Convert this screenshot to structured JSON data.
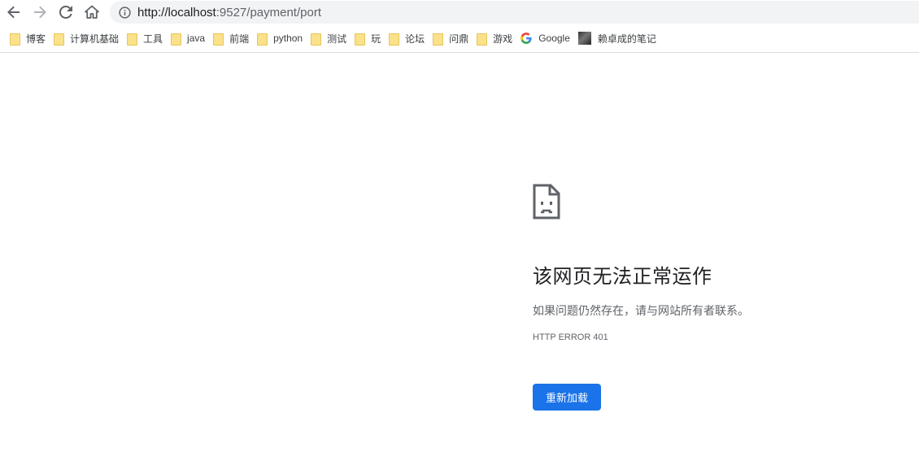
{
  "browser": {
    "url_host": "http://localhost",
    "url_rest": ":9527/payment/port",
    "icons": {
      "back": "arrow-left-icon",
      "forward": "arrow-right-icon",
      "reload": "reload-icon",
      "home": "home-icon",
      "info": "info-icon"
    }
  },
  "bookmarks": [
    {
      "label": "博客",
      "icon": "folder-icon"
    },
    {
      "label": "计算机基础",
      "icon": "folder-icon"
    },
    {
      "label": "工具",
      "icon": "folder-icon"
    },
    {
      "label": "java",
      "icon": "folder-icon"
    },
    {
      "label": "前端",
      "icon": "folder-icon"
    },
    {
      "label": "python",
      "icon": "folder-icon"
    },
    {
      "label": "测试",
      "icon": "folder-icon"
    },
    {
      "label": "玩",
      "icon": "folder-icon"
    },
    {
      "label": "论坛",
      "icon": "folder-icon"
    },
    {
      "label": "问鼎",
      "icon": "folder-icon"
    },
    {
      "label": "游戏",
      "icon": "folder-icon"
    },
    {
      "label": "Google",
      "icon": "google-icon"
    },
    {
      "label": "赖卓成的笔记",
      "icon": "avatar-icon"
    }
  ],
  "error": {
    "icon": "sad-page-icon",
    "title": "该网页无法正常运作",
    "description": "如果问题仍然存在，请与网站所有者联系。",
    "code": "HTTP ERROR 401",
    "reload_label": "重新加载"
  },
  "colors": {
    "accent": "#1a73e8",
    "folder": "#fbe189",
    "omnibox_bg": "#f1f3f4"
  }
}
